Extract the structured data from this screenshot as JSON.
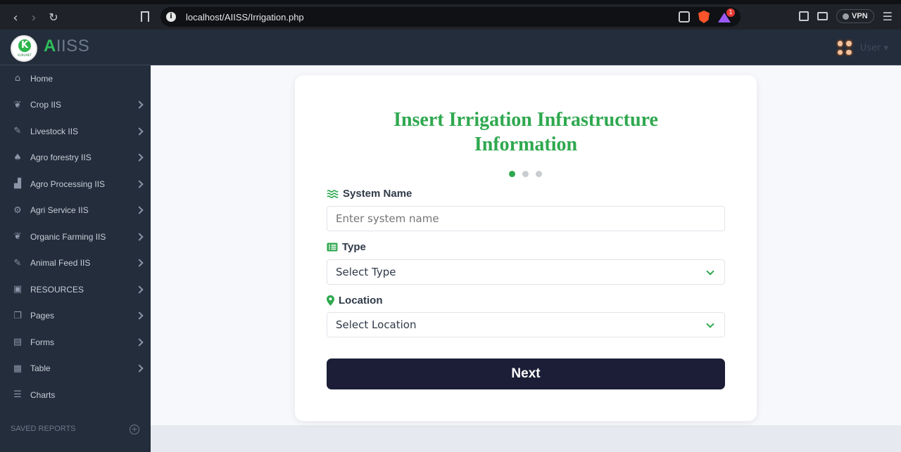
{
  "browser": {
    "url": "localhost/AIISS/Irrigation.php",
    "vpn_label": "VPN",
    "rewards_badge": "1"
  },
  "app": {
    "brand_first": "A",
    "brand_rest": "IISS",
    "logo_text": "K",
    "user_label": "User"
  },
  "sidebar": {
    "items": [
      {
        "label": "Home",
        "icon": "home-icon",
        "chevron": false
      },
      {
        "label": "Crop IIS",
        "icon": "sprout-icon",
        "chevron": true
      },
      {
        "label": "Livestock IIS",
        "icon": "livestock-icon",
        "chevron": true
      },
      {
        "label": "Agro forestry IIS",
        "icon": "bell-icon",
        "chevron": true
      },
      {
        "label": "Agro Processing IIS",
        "icon": "industry-icon",
        "chevron": true
      },
      {
        "label": "Agri Service IIS",
        "icon": "tractor-icon",
        "chevron": true
      },
      {
        "label": "Organic Farming IIS",
        "icon": "sprout-icon",
        "chevron": true
      },
      {
        "label": "Animal Feed IIS",
        "icon": "livestock-icon",
        "chevron": true
      },
      {
        "label": "RESOURCES",
        "icon": "briefcase-icon",
        "chevron": true
      },
      {
        "label": "Pages",
        "icon": "copy-icon",
        "chevron": true
      },
      {
        "label": "Forms",
        "icon": "file-icon",
        "chevron": true
      },
      {
        "label": "Table",
        "icon": "table-icon",
        "chevron": true
      },
      {
        "label": "Charts",
        "icon": "chart-icon",
        "chevron": false
      }
    ],
    "saved_reports": "SAVED REPORTS"
  },
  "form": {
    "title_line1": "Insert Irrigation Infrastructure",
    "title_line2": "Information",
    "system_name_label": "System Name",
    "system_name_placeholder": "Enter system name",
    "type_label": "Type",
    "type_value": "Select Type",
    "location_label": "Location",
    "location_value": "Select Location",
    "next_label": "Next",
    "step": 1,
    "step_count": 3
  },
  "colors": {
    "accent": "#2fa84f",
    "sidebar_bg": "#232d3b",
    "button_bg": "#1b1e36"
  }
}
